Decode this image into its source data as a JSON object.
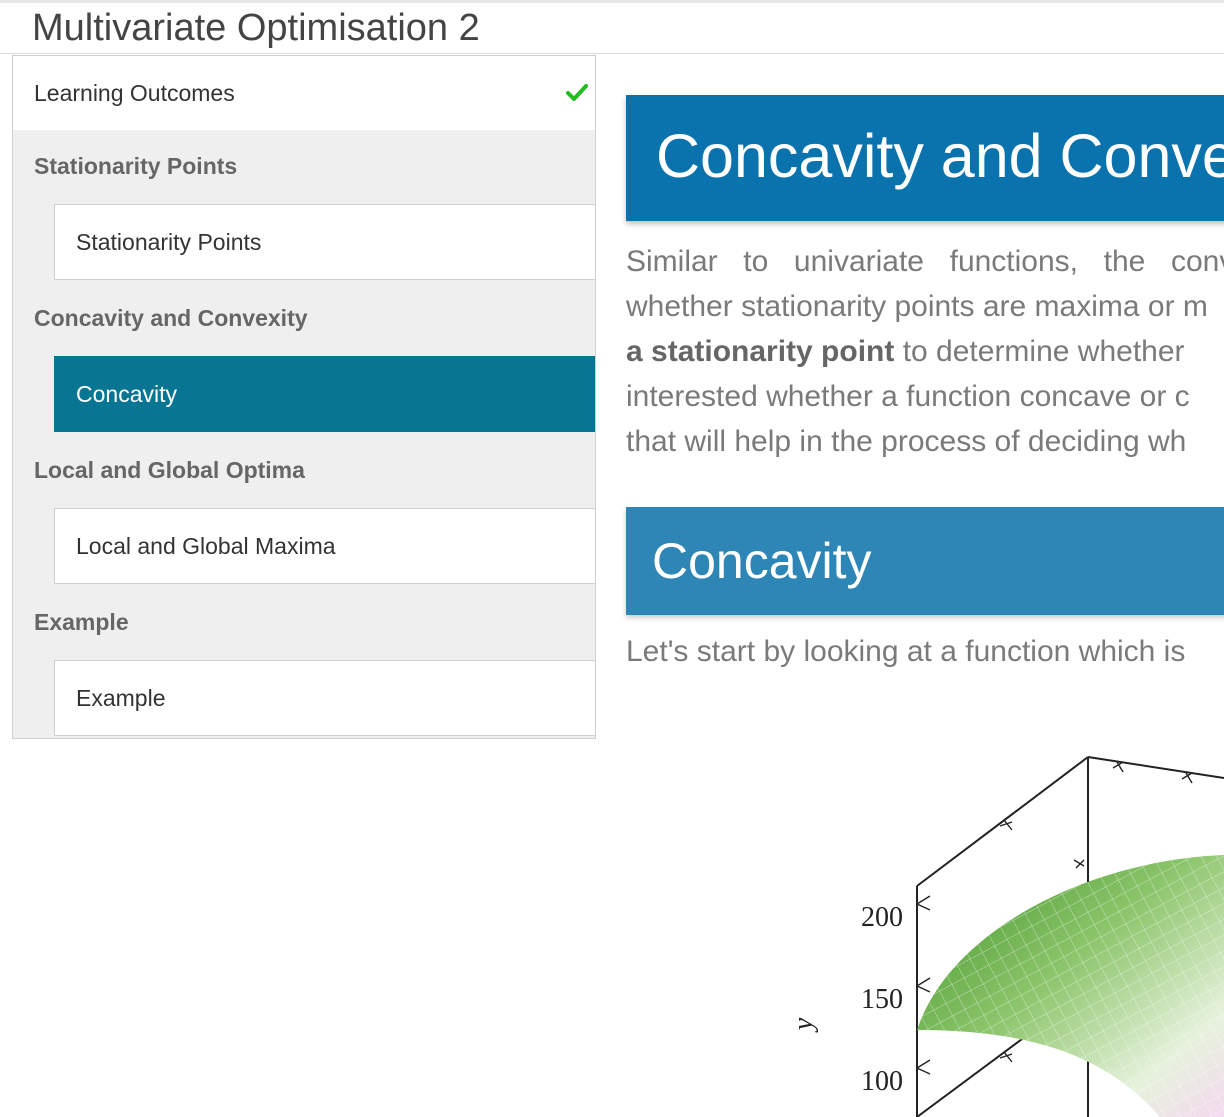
{
  "page_title": "Multivariate Optimisation 2",
  "sidebar": {
    "learning_outcomes": {
      "label": "Learning Outcomes",
      "status_icon": "check-icon",
      "status_color": "#22bb22"
    },
    "sections": [
      {
        "heading": "Stationarity Points",
        "items": [
          {
            "label": "Stationarity Points",
            "active": false
          }
        ]
      },
      {
        "heading": "Concavity and Convexity",
        "items": [
          {
            "label": "Concavity",
            "active": true
          }
        ]
      },
      {
        "heading": "Local and Global Optima",
        "items": [
          {
            "label": "Local and Global Maxima",
            "active": false
          }
        ]
      },
      {
        "heading": "Example",
        "items": [
          {
            "label": "Example",
            "active": false
          }
        ]
      }
    ]
  },
  "main": {
    "section_title": "Concavity and Conve",
    "intro_lines": [
      "Similar to univariate functions, the convex",
      "whether stationarity points are maxima or m",
      {
        "bold": "a stationarity point",
        "rest": " to determine whether"
      },
      "interested whether a function concave or c",
      "that will help in the process of deciding wh"
    ],
    "subsection_title": "Concavity",
    "lead_text": "Let's start by looking at a function which is",
    "figure": {
      "axis_label": "y",
      "tick_labels": [
        "200",
        "150",
        "100"
      ]
    }
  },
  "colors": {
    "active_item": "#087593",
    "banner_main": "#0a72ad",
    "banner_sub": "#2d86b6"
  }
}
